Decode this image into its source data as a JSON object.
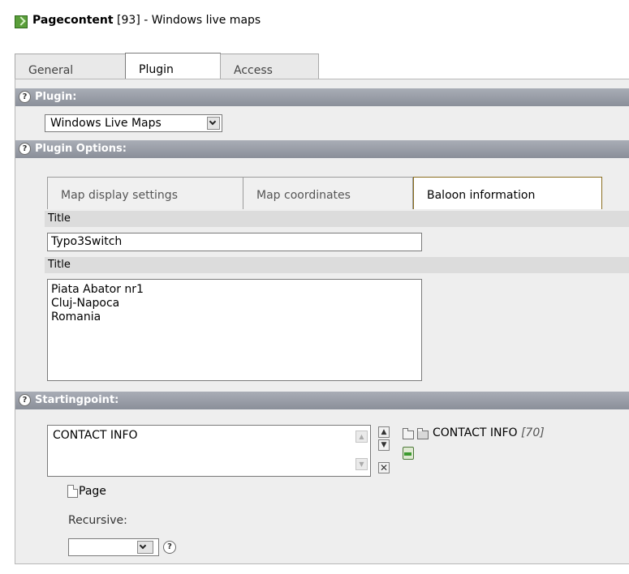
{
  "header": {
    "title_bold": "Pagecontent",
    "title_rest": " [93] - Windows live maps"
  },
  "tabs": [
    {
      "label": "General",
      "active": false
    },
    {
      "label": "Plugin",
      "active": true
    },
    {
      "label": "Access",
      "active": false
    }
  ],
  "plugin": {
    "section_label": "Plugin:",
    "selected": "Windows Live Maps"
  },
  "plugin_options": {
    "section_label": "Plugin Options:",
    "inner_tabs": [
      {
        "label": "Map display settings",
        "active": false
      },
      {
        "label": "Map coordinates",
        "active": false
      },
      {
        "label": "Baloon information",
        "active": true
      }
    ],
    "title_label": "Title",
    "title_value": "Typo3Switch",
    "text_label": "Title",
    "text_value": "Piata Abator nr1\nCluj-Napoca\nRomania"
  },
  "startingpoint": {
    "section_label": "Startingpoint:",
    "list_item": "CONTACT INFO",
    "selected_label": "CONTACT INFO",
    "selected_id": "[70]",
    "page_label": "Page",
    "recursive_label": "Recursive:",
    "recursive_value": ""
  },
  "colors": {
    "section_header": "#9a9ea8",
    "active_inner_tab_border": "#8a6d1f"
  }
}
